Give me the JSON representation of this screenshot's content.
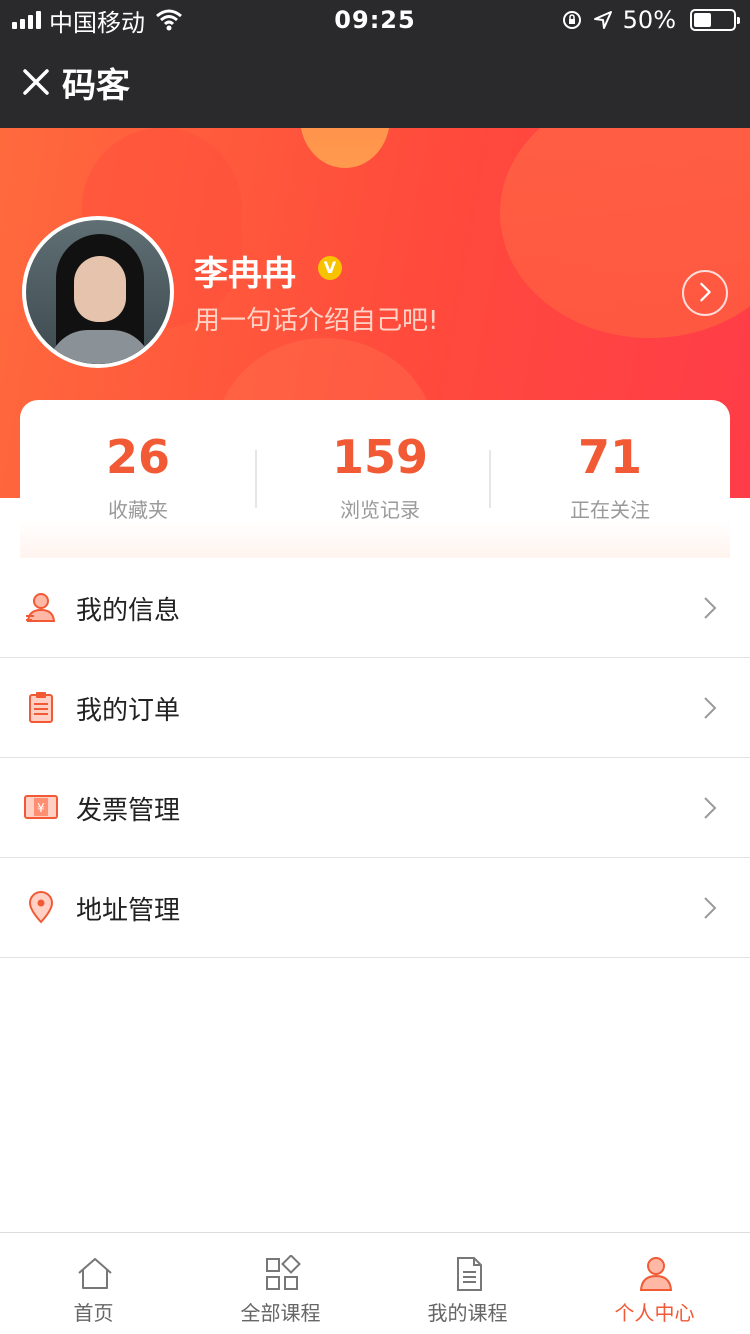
{
  "status_bar": {
    "carrier": "中国移动",
    "time": "09:25",
    "battery_text": "50%",
    "battery_level": 0.5
  },
  "nav": {
    "title": "码客"
  },
  "profile": {
    "name": "李冉冉",
    "verified_badge": "V",
    "bio": "用一句话介绍自己吧!"
  },
  "stats": [
    {
      "value": "26",
      "label": "收藏夹"
    },
    {
      "value": "159",
      "label": "浏览记录"
    },
    {
      "value": "71",
      "label": "正在关注"
    }
  ],
  "menu": [
    {
      "label": "我的信息",
      "icon": "user-icon"
    },
    {
      "label": "我的订单",
      "icon": "clipboard-icon"
    },
    {
      "label": "发票管理",
      "icon": "invoice-icon"
    },
    {
      "label": "地址管理",
      "icon": "location-pin-icon"
    }
  ],
  "tabs": [
    {
      "label": "首页",
      "icon": "home-icon"
    },
    {
      "label": "全部课程",
      "icon": "grid-icon"
    },
    {
      "label": "我的课程",
      "icon": "document-icon"
    },
    {
      "label": "个人中心",
      "icon": "person-icon"
    }
  ],
  "colors": {
    "accent": "#f15a35",
    "header_start": "#ff6a3d",
    "header_end": "#ff3c48",
    "nav_bg": "#2a2a2c",
    "verified": "#f7c300"
  }
}
